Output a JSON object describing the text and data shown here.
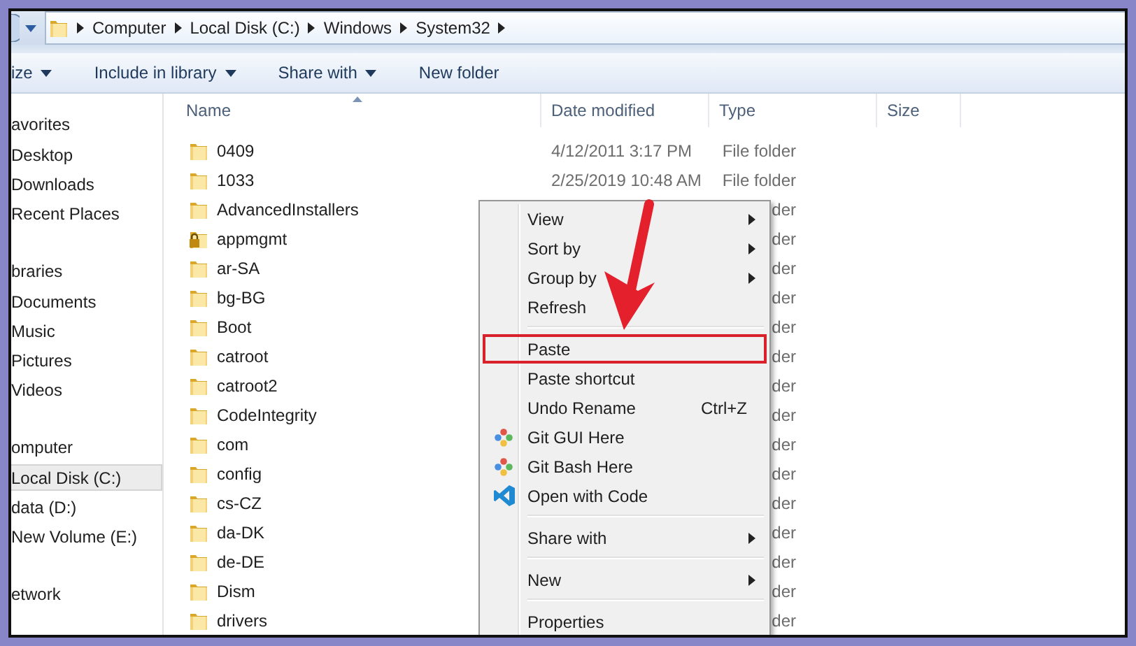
{
  "address_bar": {
    "breadcrumbs": [
      "Computer",
      "Local Disk (C:)",
      "Windows",
      "System32"
    ]
  },
  "toolbar": [
    {
      "label": "ize",
      "dropdown": true
    },
    {
      "label": "Include in library",
      "dropdown": true
    },
    {
      "label": "Share with",
      "dropdown": true
    },
    {
      "label": "New folder",
      "dropdown": false
    }
  ],
  "sidebar": {
    "groups": [
      {
        "label": "avorites",
        "items": [
          {
            "label": "Desktop",
            "selected": false
          },
          {
            "label": "Downloads",
            "selected": false
          },
          {
            "label": "Recent Places",
            "selected": false
          }
        ]
      },
      {
        "label": "braries",
        "items": [
          {
            "label": "Documents",
            "selected": false
          },
          {
            "label": "Music",
            "selected": false
          },
          {
            "label": "Pictures",
            "selected": false
          },
          {
            "label": "Videos",
            "selected": false
          }
        ]
      },
      {
        "label": "omputer",
        "items": [
          {
            "label": "Local Disk (C:)",
            "selected": true
          },
          {
            "label": "data (D:)",
            "selected": false
          },
          {
            "label": "New Volume (E:)",
            "selected": false
          }
        ]
      },
      {
        "label": "etwork"
      }
    ]
  },
  "table": {
    "columns": [
      {
        "label": "Name",
        "sorted": true
      },
      {
        "label": "Date modified",
        "sorted": false
      },
      {
        "label": "Type",
        "sorted": false
      },
      {
        "label": "Size",
        "sorted": false
      }
    ],
    "rows": [
      {
        "name": "0409",
        "date": "4/12/2011 3:17 PM",
        "type": "File folder",
        "locked": false
      },
      {
        "name": "1033",
        "date": "2/25/2019 10:48 AM",
        "type": "File folder",
        "locked": false
      },
      {
        "name": "AdvancedInstallers",
        "type": "der",
        "locked": false
      },
      {
        "name": "appmgmt",
        "type": "der",
        "locked": true
      },
      {
        "name": "ar-SA",
        "type": "der",
        "locked": false
      },
      {
        "name": "bg-BG",
        "type": "der",
        "locked": false
      },
      {
        "name": "Boot",
        "type": "der",
        "locked": false
      },
      {
        "name": "catroot",
        "type": "der",
        "locked": false
      },
      {
        "name": "catroot2",
        "type": "der",
        "locked": false
      },
      {
        "name": "CodeIntegrity",
        "type": "der",
        "locked": false
      },
      {
        "name": "com",
        "type": "der",
        "locked": false
      },
      {
        "name": "config",
        "type": "der",
        "locked": false
      },
      {
        "name": "cs-CZ",
        "type": "der",
        "locked": false
      },
      {
        "name": "da-DK",
        "type": "der",
        "locked": false
      },
      {
        "name": "de-DE",
        "type": "der",
        "locked": false
      },
      {
        "name": "Dism",
        "type": "der",
        "locked": false
      },
      {
        "name": "drivers",
        "type": "der",
        "locked": false
      }
    ]
  },
  "context_menu": [
    {
      "kind": "item",
      "label": "View",
      "submenu": true,
      "annotated": false
    },
    {
      "kind": "item",
      "label": "Sort by",
      "submenu": true,
      "annotated": false
    },
    {
      "kind": "item",
      "label": "Group by",
      "submenu": true,
      "annotated": false
    },
    {
      "kind": "item",
      "label": "Refresh",
      "submenu": false,
      "annotated": false
    },
    {
      "kind": "separator"
    },
    {
      "kind": "item",
      "label": "Paste",
      "submenu": false,
      "annotated": true
    },
    {
      "kind": "item",
      "label": "Paste shortcut",
      "submenu": false,
      "annotated": false
    },
    {
      "kind": "item",
      "label": "Undo Rename",
      "shortcut": "Ctrl+Z",
      "submenu": false,
      "annotated": false
    },
    {
      "kind": "git",
      "label": "Git GUI Here",
      "submenu": false,
      "annotated": false
    },
    {
      "kind": "git",
      "label": "Git Bash Here",
      "submenu": false,
      "annotated": false
    },
    {
      "kind": "code",
      "label": "Open with Code",
      "submenu": false,
      "annotated": false
    },
    {
      "kind": "separator"
    },
    {
      "kind": "item",
      "label": "Share with",
      "submenu": true,
      "annotated": false
    },
    {
      "kind": "separator"
    },
    {
      "kind": "item",
      "label": "New",
      "submenu": true,
      "annotated": false
    },
    {
      "kind": "separator"
    },
    {
      "kind": "item",
      "label": "Properties",
      "submenu": false,
      "annotated": false
    }
  ],
  "annotations": [
    {
      "kind": "arrow"
    }
  ]
}
